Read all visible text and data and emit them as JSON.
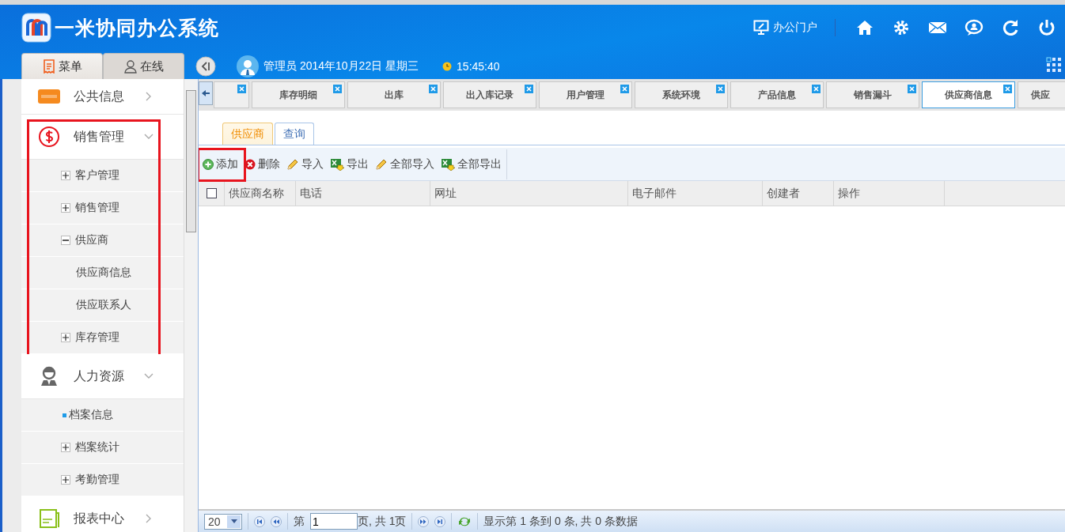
{
  "header": {
    "title": "一米协同办公系统",
    "portal_link": "办公门户",
    "user": "管理员 2014年10月22日 星期三",
    "time": "15:45:40"
  },
  "panel_tabs": [
    {
      "label": "菜单",
      "selected": true
    },
    {
      "label": "在线",
      "selected": false
    }
  ],
  "sidebar": {
    "items": [
      {
        "label": "公共信息",
        "expanded": false,
        "highlighted": false
      },
      {
        "label": "销售管理",
        "expanded": true,
        "highlighted": true,
        "children": [
          {
            "label": "客户管理",
            "kind": "folder",
            "expanded": false
          },
          {
            "label": "销售管理",
            "kind": "folder",
            "expanded": false
          },
          {
            "label": "供应商",
            "kind": "folder",
            "expanded": true,
            "children": [
              {
                "label": "供应商信息",
                "kind": "plain"
              },
              {
                "label": "供应联系人",
                "kind": "plain"
              }
            ]
          },
          {
            "label": "库存管理",
            "kind": "folder",
            "expanded": false
          }
        ]
      },
      {
        "label": "人力资源",
        "expanded": true,
        "highlighted": false,
        "children": [
          {
            "label": "档案信息",
            "kind": "bullet"
          },
          {
            "label": "档案统计",
            "kind": "folder",
            "expanded": false
          },
          {
            "label": "考勤管理",
            "kind": "folder",
            "expanded": false
          }
        ]
      },
      {
        "label": "报表中心",
        "expanded": false,
        "highlighted": false
      }
    ]
  },
  "page_tabs": [
    {
      "selected": false
    },
    {
      "label": "库存明细",
      "selected": false
    },
    {
      "label": "出库",
      "selected": false
    },
    {
      "label": "出入库记录",
      "selected": false
    },
    {
      "label": "用户管理",
      "selected": false
    },
    {
      "label": "系统环境",
      "selected": false
    },
    {
      "label": "产品信息",
      "selected": false
    },
    {
      "label": "销售漏斗",
      "selected": false
    },
    {
      "label": "供应商信息",
      "selected": true
    },
    {
      "label": "供应",
      "selected": false
    }
  ],
  "content_tabs": [
    {
      "label": "供应商",
      "selected": true
    },
    {
      "label": "查询",
      "selected": false
    }
  ],
  "toolbar": [
    {
      "label": "添加",
      "highlighted": true
    },
    {
      "label": "删除",
      "highlighted": false
    },
    {
      "label": "导入",
      "highlighted": false
    },
    {
      "label": "导出",
      "highlighted": false
    },
    {
      "label": "全部导入",
      "highlighted": false
    },
    {
      "label": "全部导出",
      "highlighted": false
    }
  ],
  "table": {
    "select_all": false,
    "columns": [
      "供应商名称",
      "电话",
      "网址",
      "电子邮件",
      "创建者",
      "操作"
    ]
  },
  "pager": {
    "page_size": "20",
    "page_label": "第",
    "page": "1",
    "page_total": "页, 共 1页",
    "summary": "显示第 1 条到 0 条, 共 0 条数据"
  }
}
